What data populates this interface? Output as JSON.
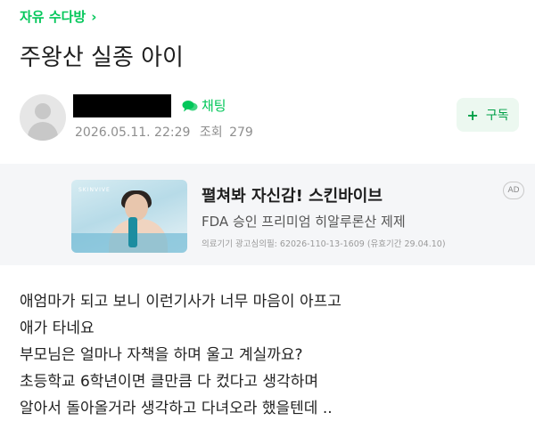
{
  "breadcrumb": {
    "label": "자유 수다방",
    "chevron": "›"
  },
  "post": {
    "title": "주왕산 실종 아이"
  },
  "author": {
    "chat_label": "채팅",
    "date": "2026.05.11. 22:29",
    "views_label": "조회",
    "views": "279",
    "subscribe_label": "구독"
  },
  "ad": {
    "badge": "AD",
    "brand_mark": "SKINVIVE",
    "headline": "펼쳐봐 자신감! 스킨바이브",
    "subline": "FDA 승인 프리미엄 히알루론산 제제",
    "fine_print": "의료기기 광고심의필: 62026-110-13-1609 (유효기간 29.04.10)"
  },
  "body": {
    "lines": [
      "애엄마가 되고 보니 이런기사가 너무 마음이 아프고",
      "애가 타네요",
      "부모님은 얼마나 자책을 하며 울고 계실까요?",
      "초등학교 6학년이면 클만큼 다 컸다고 생각하며",
      "알아서 돌아올거라 생각하고 다녀오라 했을텐데 .."
    ]
  },
  "icons": {
    "chevron": "chevron-right-icon",
    "chat": "chat-bubble-icon",
    "plus": "plus-icon",
    "avatar": "default-profile-icon"
  },
  "colors": {
    "accent": "#03c75a",
    "subscribe_bg": "#ecf8f0",
    "ad_bg": "#f5f6f8",
    "meta_text": "#8e8e8e"
  }
}
